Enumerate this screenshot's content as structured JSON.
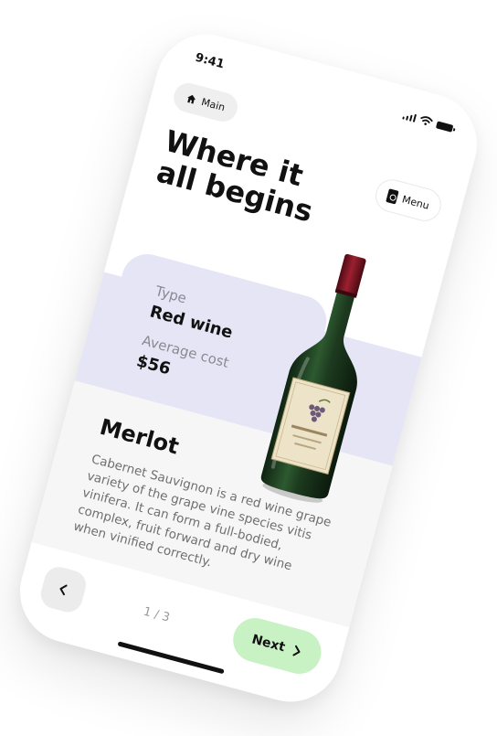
{
  "status_bar": {
    "time": "9:41"
  },
  "nav": {
    "main_label": "Main",
    "menu_label": "Menu"
  },
  "hero": {
    "title_line1": "Where it",
    "title_line2": "all begins"
  },
  "info": {
    "type_label": "Type",
    "type_value": "Red wine",
    "cost_label": "Average cost",
    "cost_value": "$56"
  },
  "wine": {
    "name": "Merlot",
    "description": "Cabernet Sauvignon is a red wine grape variety of the grape vine species vitis vinifera. It can form a full-bodied, complex, fruit forward and dry wine when vinified correctly."
  },
  "footer": {
    "pager": "1 / 3",
    "next_label": "Next"
  },
  "colors": {
    "card_lavender": "#e6e5f5",
    "next_green": "#c9f2c4",
    "sheet_gray": "#f6f6f6",
    "bottle_green": "#1d3a1f",
    "cap_red": "#7a1522"
  },
  "icons": {
    "main": "home-icon",
    "menu": "menu-doc-icon",
    "back": "chevron-left-icon",
    "next": "chevron-right-icon"
  }
}
